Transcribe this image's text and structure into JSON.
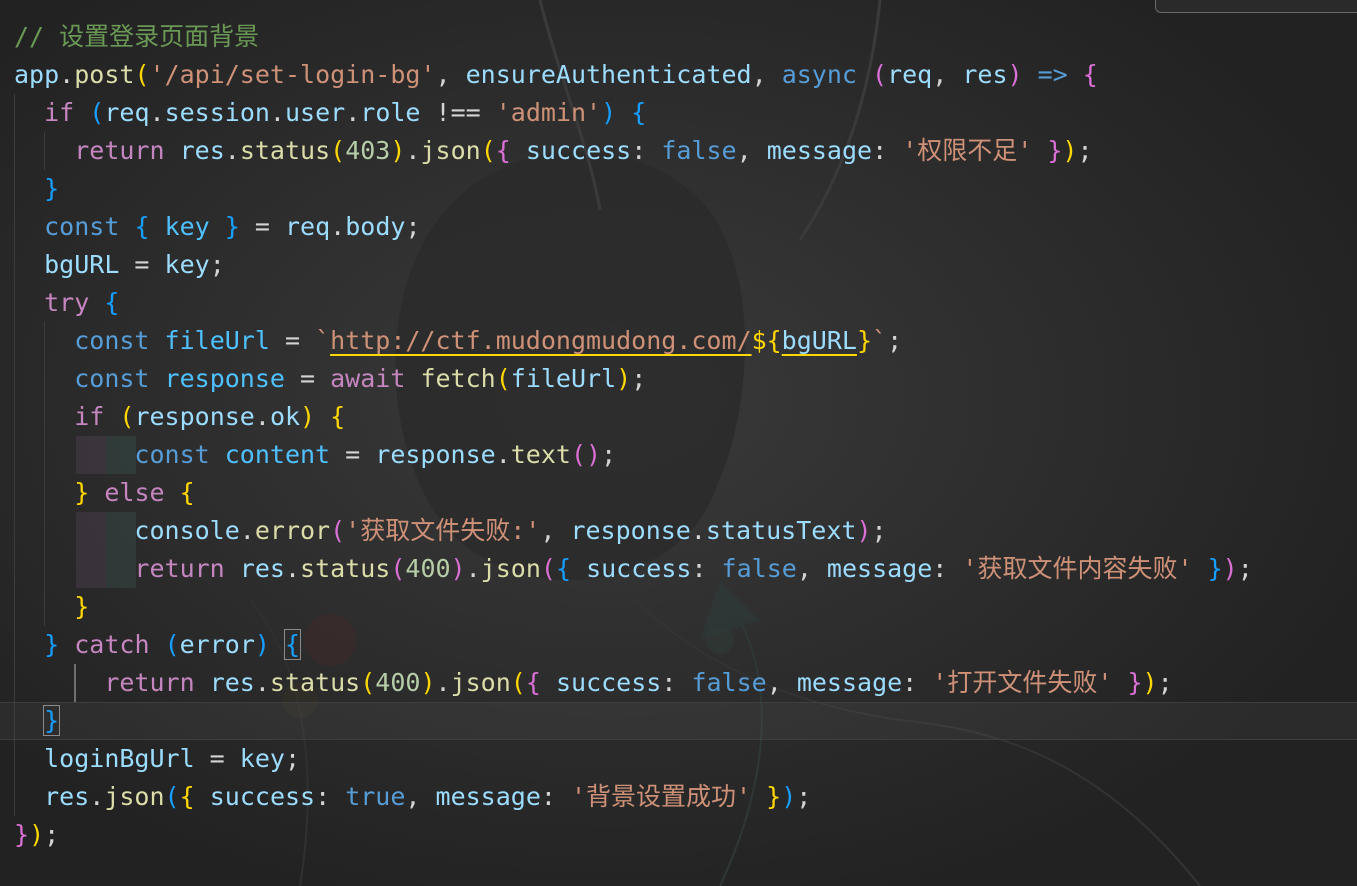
{
  "editor": {
    "lines": [
      "// 设置登录页面背景",
      "app.post('/api/set-login-bg', ensureAuthenticated, async (req, res) => {",
      "  if (req.session.user.role !== 'admin') {",
      "    return res.status(403).json({ success: false, message: '权限不足' });",
      "  }",
      "  const { key } = req.body;",
      "  bgURL = key;",
      "  try {",
      "    const fileUrl = `http://ctf.mudongmudong.com/${bgURL}`;",
      "    const response = await fetch(fileUrl);",
      "    if (response.ok) {",
      "        const content = response.text();",
      "    } else {",
      "        console.error('获取文件失败:', response.statusText);",
      "        return res.status(400).json({ success: false, message: '获取文件内容失败' });",
      "    }",
      "  } catch (error) {",
      "      return res.status(400).json({ success: false, message: '打开文件失败' });",
      "  }",
      "  loginBgUrl = key;",
      "  res.json({ success: true, message: '背景设置成功' });",
      "});"
    ],
    "tokens": {
      "comment": "// 设置登录页面背景",
      "route_path": "'/api/set-login-bg'",
      "middleware": "ensureAuthenticated",
      "role_value": "'admin'",
      "status_403": "403",
      "status_400": "400",
      "msg_no_permission": "'权限不足'",
      "url_prefix": "http://ctf.mudongmudong.com/",
      "url_var": "bgURL",
      "err_fetch_failed": "'获取文件失败:'",
      "msg_fetch_content_failed": "'获取文件内容失败'",
      "msg_open_failed": "'打开文件失败'",
      "msg_success": "'背景设置成功'"
    },
    "theme": {
      "background": "#1e1e1e",
      "keyword": "#569cd6",
      "control": "#c586c0",
      "function": "#dcdcaa",
      "variable": "#9cdcfe",
      "string": "#ce9178",
      "number": "#b5cea8",
      "comment": "#6a9955"
    }
  }
}
